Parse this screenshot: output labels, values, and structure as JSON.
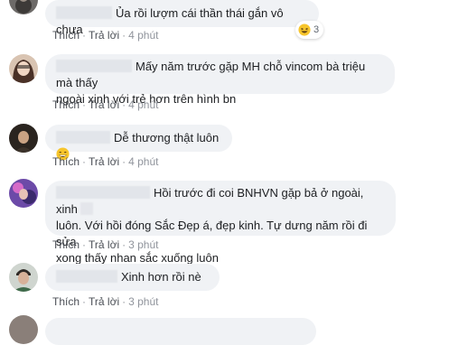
{
  "colors": {
    "bubble_bg": "#f0f2f5",
    "link": "#4b4f56",
    "time": "#90949c",
    "emoji_yellow": "#f7c52b"
  },
  "actions": {
    "like": "Thích",
    "reply": "Trả lời",
    "separator": "·"
  },
  "comments": [
    {
      "text": "Ủa rồi lượm cái thần thái gắn vô chưa",
      "time": "4 phút",
      "reaction_icon": "laughing-emoji-icon",
      "reaction_count": "3"
    },
    {
      "text_line1": "Mấy năm trước gặp MH chỗ vincom bà triệu mà thấy",
      "text_line2": "ngoài xinh với trẻ hơn trên hình bn",
      "time": "4 phút"
    },
    {
      "text": "Dễ thương thật luôn",
      "emoji_icon": "grinning-emoji-icon",
      "time": "4 phút"
    },
    {
      "text_line1": "Hồi trước đi coi BNHVN gặp bả ở ngoài, xinh",
      "text_line2": "luôn. Với hồi đóng Sắc Đẹp á, đẹp kinh. Tự dưng năm rồi đi sửa",
      "text_line3": "xong thấy nhan sắc xuống luôn",
      "time": "3 phút"
    },
    {
      "text": "Xinh hơn rồi nè",
      "time": "3 phút"
    }
  ]
}
